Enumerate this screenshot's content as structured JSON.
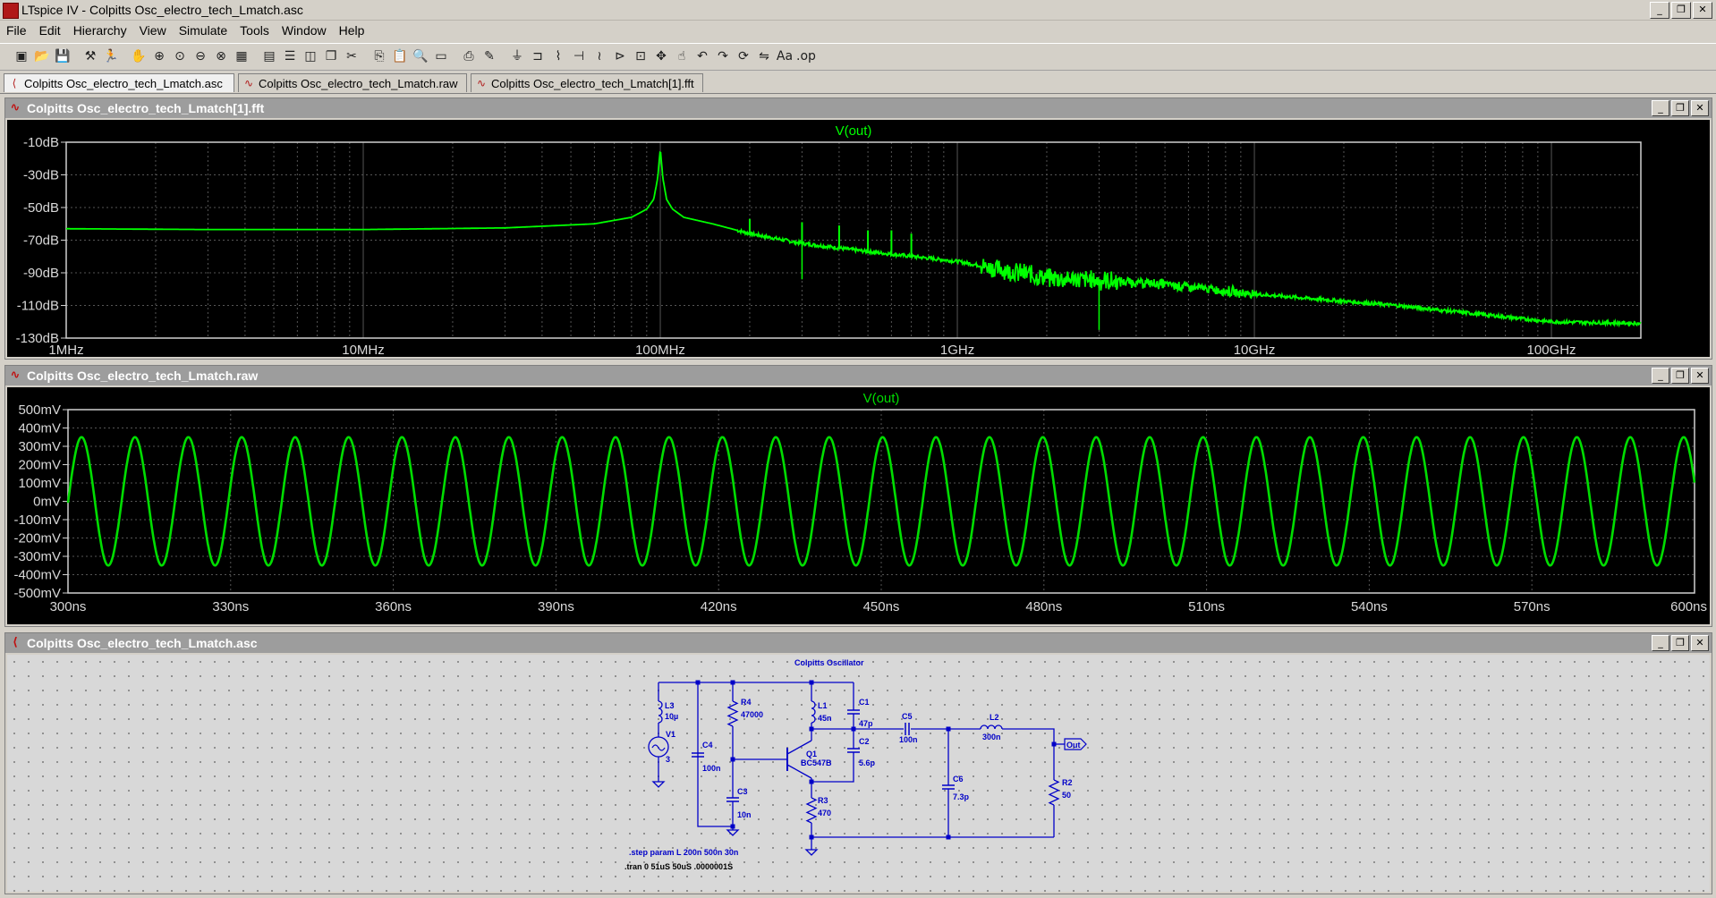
{
  "window": {
    "title": "LTspice IV - Colpitts Osc_electro_tech_Lmatch.asc",
    "minimize": "_",
    "restore": "❐",
    "close": "✕"
  },
  "menu": [
    "File",
    "Edit",
    "Hierarchy",
    "View",
    "Simulate",
    "Tools",
    "Window",
    "Help"
  ],
  "toolbar_icons": [
    "new-schematic-icon",
    "open-icon",
    "save-icon",
    "control-panel-icon",
    "run-icon",
    "halt-icon",
    "zoom-in-icon",
    "zoom-pan-icon",
    "zoom-out-icon",
    "zoom-fit-icon",
    "autorange-icon",
    "grid-icon",
    "tile-horizontal-icon",
    "tile-vertical-icon",
    "cascade-icon",
    "cut-icon",
    "copy-icon",
    "paste-icon",
    "find-icon",
    "print-preview-icon",
    "print-icon",
    "wire-icon",
    "ground-icon",
    "label-icon",
    "resistor-icon",
    "capacitor-icon",
    "inductor-icon",
    "diode-icon",
    "component-icon",
    "move-icon",
    "drag-icon",
    "undo-icon",
    "redo-icon",
    "rotate-icon",
    "mirror-icon",
    "text-icon",
    "spice-directive-icon"
  ],
  "tabs": [
    {
      "label": "Colpitts Osc_electro_tech_Lmatch.asc",
      "icon": "schematic-icon",
      "active": true
    },
    {
      "label": "Colpitts Osc_electro_tech_Lmatch.raw",
      "icon": "waveform-icon",
      "active": false
    },
    {
      "label": "Colpitts Osc_electro_tech_Lmatch[1].fft",
      "icon": "waveform-icon",
      "active": false
    }
  ],
  "fft_pane": {
    "title": "Colpitts Osc_electro_tech_Lmatch[1].fft",
    "trace_color": "#00ff00",
    "chart_data": {
      "type": "line",
      "title": "V(out)",
      "x_scale": "log",
      "xlim_hz": [
        1000000,
        200000000000
      ],
      "ylim_db": [
        -130,
        -10
      ],
      "y_ticks": [
        "-10dB",
        "-30dB",
        "-50dB",
        "-70dB",
        "-90dB",
        "-110dB",
        "-130dB"
      ],
      "y_tick_values": [
        -10,
        -30,
        -50,
        -70,
        -90,
        -110,
        -130
      ],
      "x_ticks": [
        "1MHz",
        "10MHz",
        "100MHz",
        "1GHz",
        "10GHz",
        "100GHz"
      ],
      "x_tick_values": [
        1000000,
        10000000,
        100000000,
        1000000000,
        10000000000,
        100000000000
      ],
      "series": [
        {
          "name": "V(out)",
          "x_hz": [
            1000000,
            3000000,
            10000000,
            30000000,
            60000000,
            80000000,
            90000000,
            95000000,
            98000000,
            100000000,
            102000000,
            105000000,
            110000000,
            120000000,
            150000000,
            200000000,
            300000000,
            500000000,
            1000000000,
            2000000000,
            5000000000,
            10000000000,
            30000000000,
            100000000000,
            200000000000
          ],
          "y_db": [
            -63,
            -63.5,
            -63.5,
            -62.5,
            -60,
            -56,
            -51,
            -45,
            -32,
            -14,
            -32,
            -45,
            -51,
            -56,
            -60,
            -66,
            -72,
            -77,
            -83,
            -93,
            -97,
            -103,
            -110,
            -120,
            -121
          ],
          "spurs": [
            {
              "x_hz": 100000000,
              "y_db": -14
            },
            {
              "x_hz": 200000000,
              "y_db": -57
            },
            {
              "x_hz": 300000000,
              "y_db": -59
            },
            {
              "x_hz": 400000000,
              "y_db": -61
            },
            {
              "x_hz": 500000000,
              "y_db": -64
            },
            {
              "x_hz": 600000000,
              "y_db": -64
            },
            {
              "x_hz": 700000000,
              "y_db": -66
            }
          ],
          "dips": [
            {
              "x_hz": 300000000,
              "y_db": -94
            },
            {
              "x_hz": 3000000000,
              "y_db": -125
            }
          ],
          "noise_band_hz": [
            1200000000,
            10000000000
          ]
        }
      ]
    }
  },
  "raw_pane": {
    "title": "Colpitts Osc_electro_tech_Lmatch.raw",
    "trace_color": "#00dd00",
    "chart_data": {
      "type": "line",
      "title": "V(out)",
      "xlim_ns": [
        300,
        600
      ],
      "ylim_mv": [
        -500,
        500
      ],
      "y_ticks": [
        "500mV",
        "400mV",
        "300mV",
        "200mV",
        "100mV",
        "0mV",
        "-100mV",
        "-200mV",
        "-300mV",
        "-400mV",
        "-500mV"
      ],
      "y_tick_values": [
        500,
        400,
        300,
        200,
        100,
        0,
        -100,
        -200,
        -300,
        -400,
        -500
      ],
      "x_ticks": [
        "300ns",
        "330ns",
        "360ns",
        "390ns",
        "420ns",
        "450ns",
        "480ns",
        "510ns",
        "540ns",
        "570ns",
        "600ns"
      ],
      "x_tick_values": [
        300,
        330,
        360,
        390,
        420,
        450,
        480,
        510,
        540,
        570,
        600
      ],
      "series": [
        {
          "name": "V(out)",
          "waveform": "sine",
          "amplitude_mv": 350,
          "period_ns": 9.85,
          "first_peak_ns": 302.5
        }
      ]
    }
  },
  "schematic_pane": {
    "title": "Colpitts Osc_electro_tech_Lmatch.asc",
    "heading": "Colpitts Oscillator",
    "components": [
      {
        "ref": "L3",
        "value": "10µ"
      },
      {
        "ref": "V1",
        "value": "3"
      },
      {
        "ref": "C4",
        "value": "100n"
      },
      {
        "ref": "R4",
        "value": "47000"
      },
      {
        "ref": "C3",
        "value": "10n"
      },
      {
        "ref": "L1",
        "value": "45n"
      },
      {
        "ref": "Q1",
        "value": "BC547B"
      },
      {
        "ref": "C1",
        "value": "47p"
      },
      {
        "ref": "C2",
        "value": "5.6p"
      },
      {
        "ref": "R3",
        "value": "470"
      },
      {
        "ref": "C5",
        "value": "100n"
      },
      {
        "ref": "L2",
        "value": "300n"
      },
      {
        "ref": "C6",
        "value": "7.3p"
      },
      {
        "ref": "R2",
        "value": "50"
      }
    ],
    "net_label": "Out",
    "directives": [
      ".step param L 200n 500n 30n",
      ".tran 0 51uS 50uS .0000001S"
    ],
    "wire_color": "#0000c8"
  }
}
